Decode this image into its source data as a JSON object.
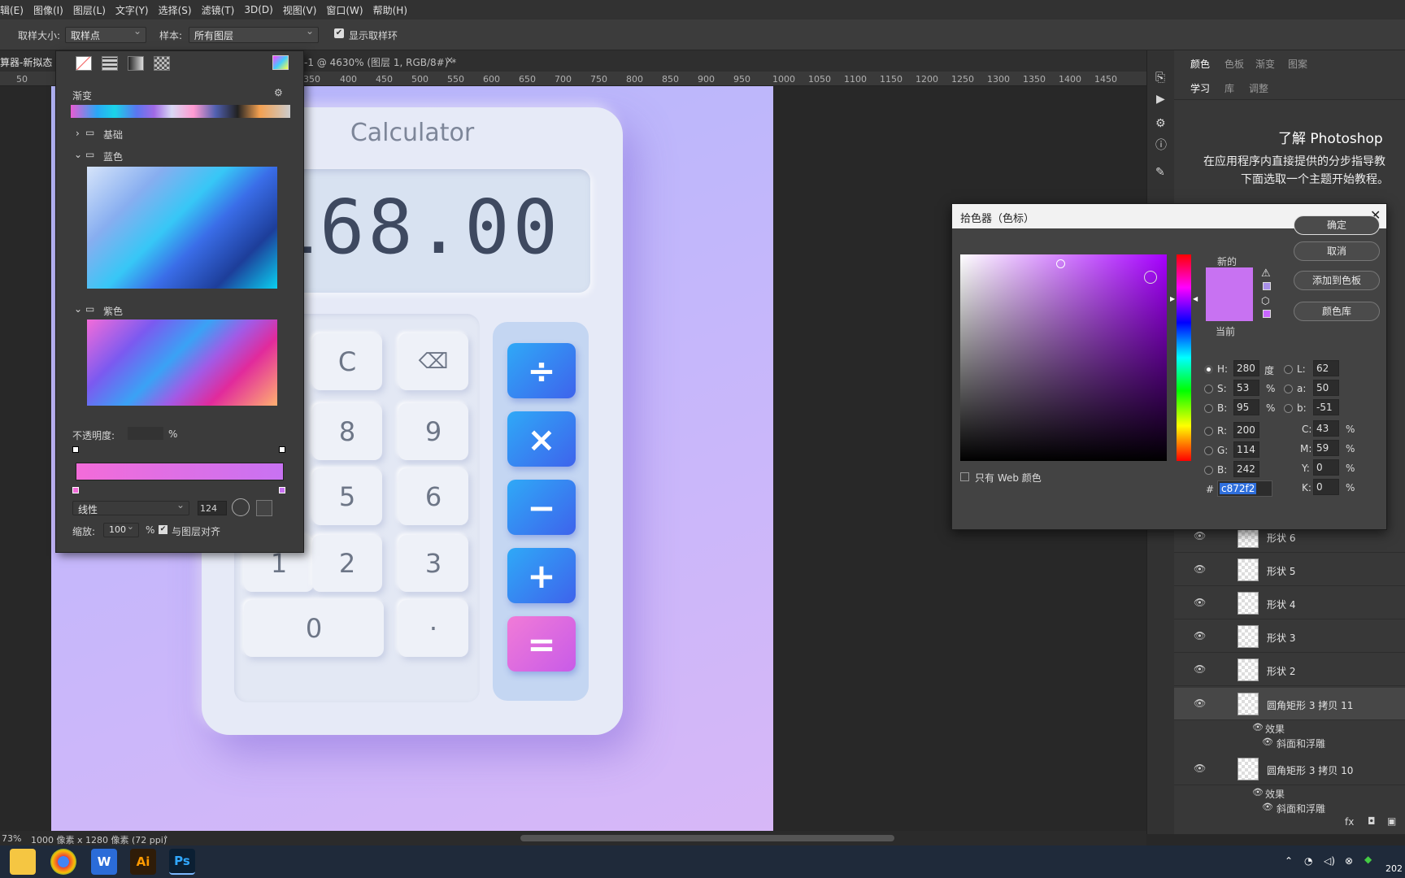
{
  "menu": [
    "辑(E)",
    "图像(I)",
    "图层(L)",
    "文字(Y)",
    "选择(S)",
    "滤镜(T)",
    "3D(D)",
    "视图(V)",
    "窗口(W)",
    "帮助(H)"
  ],
  "options": {
    "sample_size_label": "取样大小:",
    "sample_size_value": "取样点",
    "sample_label": "样本:",
    "sample_value": "所有图层",
    "show_ring": "显示取样环"
  },
  "doc": {
    "tab_prefix": "算器-新拟态",
    "tab_title": "-1 @ 4630% (图层 1, RGB/8#) *",
    "close": "×"
  },
  "ruler": [
    "50",
    "350",
    "400",
    "450",
    "500",
    "550",
    "600",
    "650",
    "700",
    "750",
    "800",
    "850",
    "900",
    "950",
    "1000",
    "1050",
    "1100",
    "1150",
    "1200",
    "1250",
    "1300",
    "1350",
    "1400",
    "1450"
  ],
  "calculator": {
    "title": "Calculator",
    "display": "168.00",
    "keys": [
      "C",
      "⌫",
      "8",
      "9",
      "5",
      "6",
      "1",
      "2",
      "3",
      "0",
      "·"
    ],
    "ops": [
      "÷",
      "×",
      "−",
      "+",
      "="
    ]
  },
  "gradient_panel": {
    "title": "渐变",
    "group_basic": "基础",
    "group_blue": "蓝色",
    "group_purple": "紫色",
    "opacity_label": "不透明度:",
    "percent": "%",
    "type": "线性",
    "angle": "124",
    "scale_label": "缩放:",
    "scale": "100",
    "align": "与图层对齐"
  },
  "picker": {
    "title": "拾色器（色标）",
    "ok": "确定",
    "cancel": "取消",
    "add_swatch": "添加到色板",
    "color_lib": "颜色库",
    "new": "新的",
    "current": "当前",
    "web_only": "只有 Web 颜色",
    "H": "280",
    "S": "53",
    "B": "95",
    "R": "200",
    "G": "114",
    "Bv": "242",
    "L": "62",
    "a": "50",
    "b": "-51",
    "C": "43",
    "M": "59",
    "Y": "0",
    "K": "0",
    "hex": "c872f2",
    "deg": "度",
    "new_color": "#c872f2"
  },
  "right_panel": {
    "tabs1": [
      "颜色",
      "色板",
      "渐变",
      "图案"
    ],
    "tabs2": [
      "学习",
      "库",
      "调整"
    ],
    "learn_title": "了解 Photoshop",
    "learn_line1": "在应用程序内直接提供的分步指导教",
    "learn_line2": "下面选取一个主题开始教程。"
  },
  "layers": [
    {
      "name": "形状 6"
    },
    {
      "name": "形状 5"
    },
    {
      "name": "形状 4"
    },
    {
      "name": "形状 3"
    },
    {
      "name": "形状 2"
    },
    {
      "name": "圆角矩形 3 拷贝 11"
    },
    {
      "name": "效果"
    },
    {
      "name": "斜面和浮雕"
    },
    {
      "name": "圆角矩形 3 拷贝 10"
    },
    {
      "name": "效果"
    },
    {
      "name": "斜面和浮雕"
    }
  ],
  "status": {
    "zoom": "73%",
    "size": "1000 像素 x 1280 像素 (72 ppi)"
  },
  "taskbar": {
    "ai": "Ai",
    "ps": "Ps",
    "year": "202"
  }
}
